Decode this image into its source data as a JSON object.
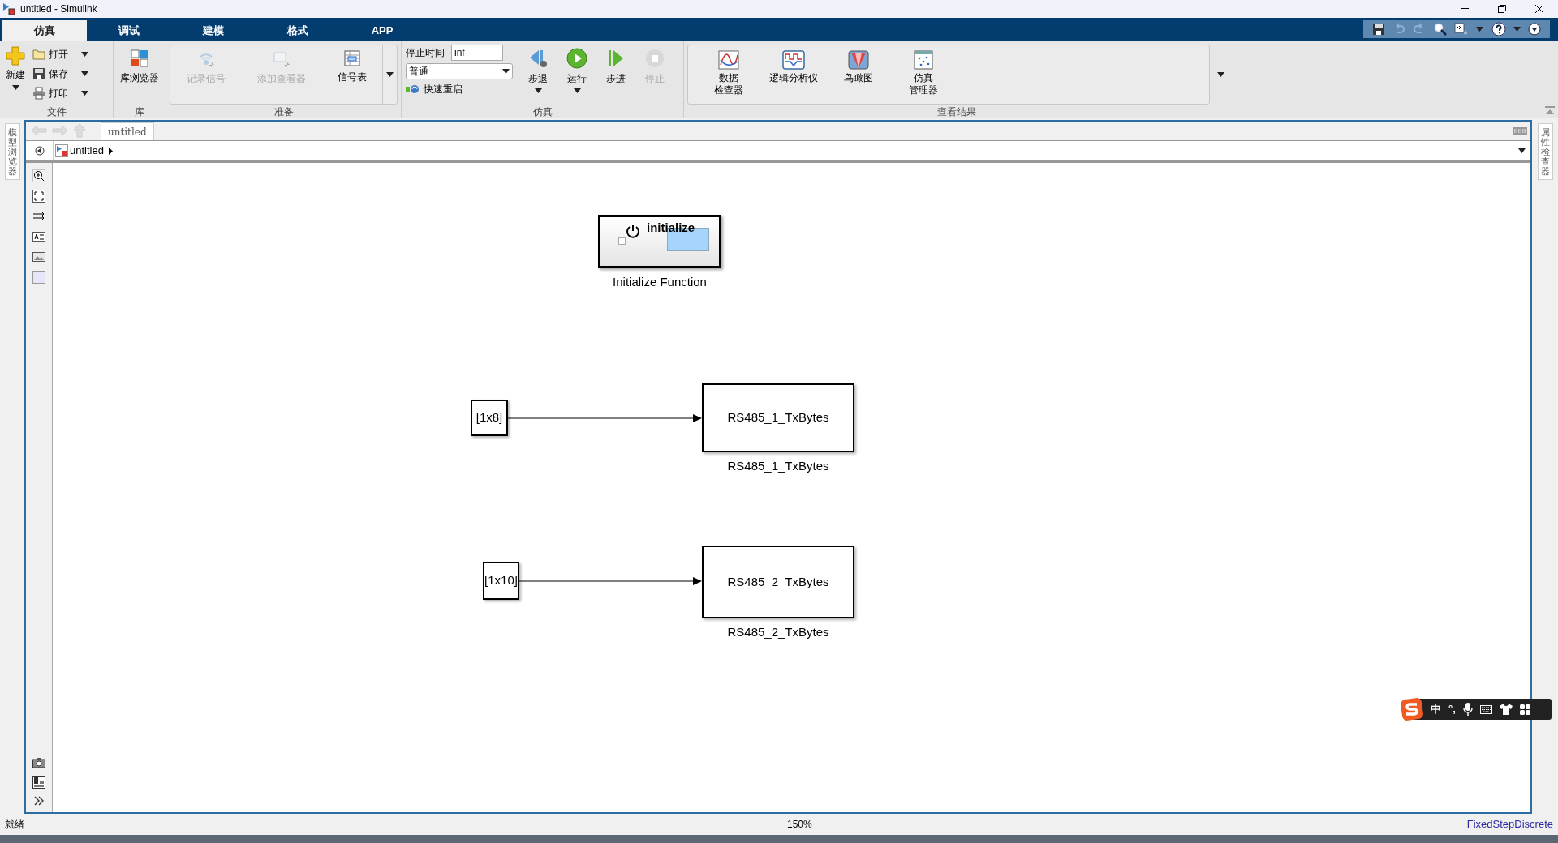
{
  "window": {
    "title": "untitled - Simulink"
  },
  "tabs": [
    {
      "label": "仿真",
      "selected": true
    },
    {
      "label": "调试",
      "selected": false
    },
    {
      "label": "建模",
      "selected": false
    },
    {
      "label": "格式",
      "selected": false
    },
    {
      "label": "APP",
      "selected": false
    }
  ],
  "ribbon": {
    "file": {
      "title": "文件",
      "new": "新建",
      "items": [
        "打开",
        "保存",
        "打印"
      ]
    },
    "library": {
      "title": "库",
      "button": "库浏览器"
    },
    "prepare": {
      "title": "准备",
      "buttons": [
        {
          "label": "记录信号",
          "disabled": true
        },
        {
          "label": "添加查看器",
          "disabled": true
        },
        {
          "label": "信号表",
          "disabled": false
        }
      ]
    },
    "simulate": {
      "title": "仿真",
      "stop_time_label": "停止时间",
      "stop_time": "inf",
      "mode": "普通",
      "fast_restart": "快速重启",
      "buttons": [
        {
          "kind": "step-back",
          "label": "步退",
          "disabled": false,
          "dropdown": true
        },
        {
          "kind": "run",
          "label": "运行",
          "disabled": false,
          "dropdown": true
        },
        {
          "kind": "step-forward",
          "label": "步进",
          "disabled": false,
          "dropdown": false
        },
        {
          "kind": "stop",
          "label": "停止",
          "disabled": true,
          "dropdown": false
        }
      ]
    },
    "review": {
      "title": "查看结果",
      "buttons": [
        {
          "kind": "inspector",
          "lines": [
            "数据",
            "检查器"
          ]
        },
        {
          "kind": "logic",
          "lines": [
            "逻辑分析仪"
          ]
        },
        {
          "kind": "birdseye",
          "lines": [
            "鸟瞰图"
          ]
        },
        {
          "kind": "manager",
          "lines": [
            "仿真",
            "管理器"
          ]
        }
      ]
    }
  },
  "left_panel": {
    "label": "模型浏览器"
  },
  "right_panel": {
    "label": "属性检查器"
  },
  "editor": {
    "tab": "untitled",
    "breadcrumb": "untitled"
  },
  "canvas": {
    "blocks": [
      {
        "kind": "initialize",
        "text": "initialize",
        "label": "Initialize Function"
      },
      {
        "kind": "constant",
        "text": "[1x8]"
      },
      {
        "kind": "subsystem",
        "text": "RS485_1_TxBytes",
        "label": "RS485_1_TxBytes"
      },
      {
        "kind": "constant",
        "text": "[1x10]"
      },
      {
        "kind": "subsystem",
        "text": "RS485_2_TxBytes",
        "label": "RS485_2_TxBytes"
      }
    ]
  },
  "ime_toolbar": {
    "mode": "中",
    "punctuation": "°,"
  },
  "status_bar": {
    "status": "就绪",
    "zoom": "150%",
    "solver": "FixedStepDiscrete"
  }
}
